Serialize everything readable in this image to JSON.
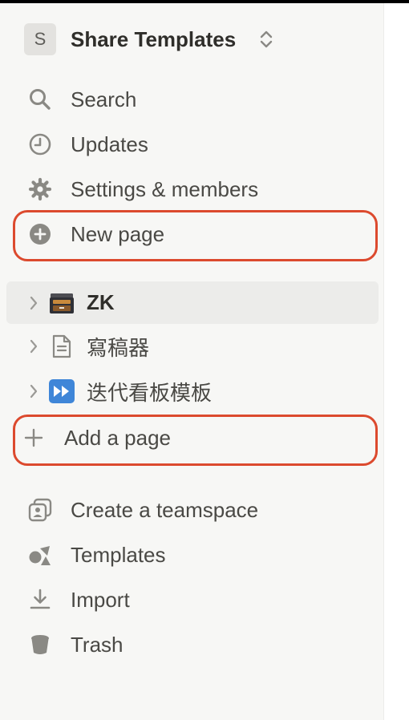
{
  "workspace": {
    "initial": "S",
    "name": "Share Templates"
  },
  "nav": [
    {
      "id": "search",
      "label": "Search",
      "icon": "search-icon"
    },
    {
      "id": "updates",
      "label": "Updates",
      "icon": "clock-icon"
    },
    {
      "id": "settings",
      "label": "Settings & members",
      "icon": "gear-icon"
    },
    {
      "id": "new-page",
      "label": "New page",
      "icon": "plus-circle-icon"
    }
  ],
  "pages": [
    {
      "label": "ZK",
      "icon": "file-cabinet-icon",
      "active": true
    },
    {
      "label": "寫稿器",
      "icon": "document-icon",
      "active": false
    },
    {
      "label": "迭代看板模板",
      "icon": "fast-forward-icon",
      "active": false
    }
  ],
  "add_page": {
    "label": "Add a page",
    "icon": "plus-icon"
  },
  "footer": [
    {
      "label": "Create a teamspace",
      "icon": "teamspace-icon"
    },
    {
      "label": "Templates",
      "icon": "shapes-icon"
    },
    {
      "label": "Import",
      "icon": "download-icon"
    },
    {
      "label": "Trash",
      "icon": "trash-icon"
    }
  ],
  "colors": {
    "highlight": "#dc4a2e",
    "sidebar_bg": "#f7f7f5",
    "active_bg": "#ececea"
  }
}
